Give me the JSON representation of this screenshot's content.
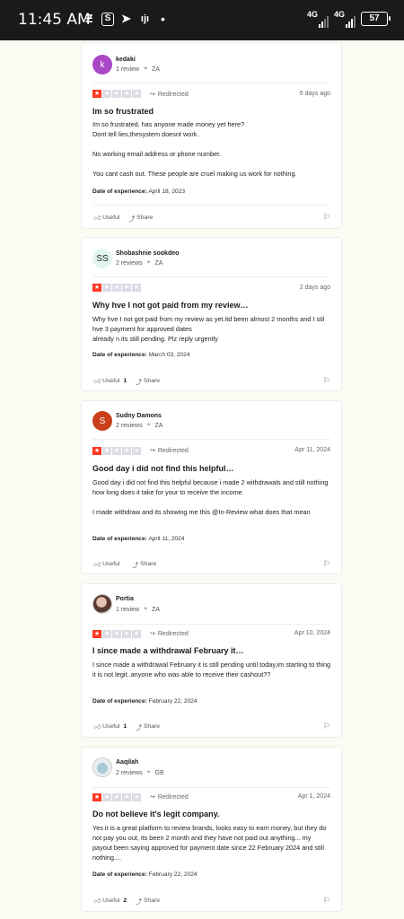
{
  "status_bar": {
    "time": "11:45 AM",
    "app_icons": [
      "notification-z-icon",
      "shortcut-s-icon",
      "telegram-icon",
      "app-icon"
    ],
    "network_1": "4G",
    "network_2": "4G",
    "battery": "57"
  },
  "labels": {
    "redirected": "Redirected",
    "date_of_experience": "Date of experience:",
    "useful": "Useful",
    "share": "Share"
  },
  "reviews": [
    {
      "avatar_letter": "k",
      "avatar_color": "#a947c6",
      "name": "kedaki",
      "review_count": "1 review",
      "country": "ZA",
      "rating": 1,
      "redirected": true,
      "date": "5 days ago",
      "title": "Im so frustrated",
      "paragraphs": [
        "Im so frustrated, has anyone made money yet here?\nDont tell lies,thesystem doesnt work.",
        "No working email address or phone number.",
        "You cant cash out. These people are cruel making us work for nothing."
      ],
      "date_of_experience": "April 18, 2023",
      "useful_count": ""
    },
    {
      "avatar_letter": "SS",
      "avatar_color": "#e3f6ee",
      "name": "Shobashnie sookdeo",
      "review_count": "2 reviews",
      "country": "ZA",
      "rating": 1,
      "redirected": false,
      "date": "2 days ago",
      "title": "Why hve I not got paid from my review…",
      "paragraphs": [
        "Why hve I not got paid from my review as yet.itd been almost 2 months and I stil hve 3 payment for approved dates\nalready n its still pending. Plz reply urgently"
      ],
      "date_of_experience": "March 03, 2024",
      "useful_count": "1"
    },
    {
      "avatar_letter": "S",
      "avatar_color": "#c9401a",
      "name": "Sudny Damons",
      "review_count": "2 reviews",
      "country": "ZA",
      "rating": 1,
      "redirected": true,
      "date": "Apr 11, 2024",
      "title": "Good day i did not find this helpful…",
      "paragraphs": [
        "Good day i did not find this helpful because i made 2 withdrawals and still nothing how long does it take for your to receive the income",
        "I made withdraw and its showing me this @In-Review what does that mean"
      ],
      "date_of_experience": "April 11, 2024",
      "useful_count": ""
    },
    {
      "avatar_letter": "",
      "avatar_color": "",
      "name": "Portia",
      "review_count": "1 review",
      "country": "ZA",
      "rating": 1,
      "redirected": true,
      "date": "Apr 10, 2024",
      "title": "I since made a withdrawal February it…",
      "paragraphs": [
        "I since made a withdrawal February it is still pending until today,im starting to thing it is not legit..anyone who was able to receive their cashout??"
      ],
      "date_of_experience": "February 22, 2024",
      "useful_count": "1"
    },
    {
      "avatar_letter": "",
      "avatar_color": "",
      "name": "Aaqilah",
      "review_count": "2 reviews",
      "country": "GB",
      "rating": 1,
      "redirected": true,
      "date": "Apr 1, 2024",
      "title": "Do not believe it's legit company.",
      "paragraphs": [
        "Yes it is a great platform to review brands, looks easy to earn money, but they do not pay you out, its been 2 month and they have not paid out anything... my payout been saying approved for payment date since 22 February 2024 and still nothing...."
      ],
      "date_of_experience": "February 22, 2024",
      "useful_count": "2"
    }
  ]
}
